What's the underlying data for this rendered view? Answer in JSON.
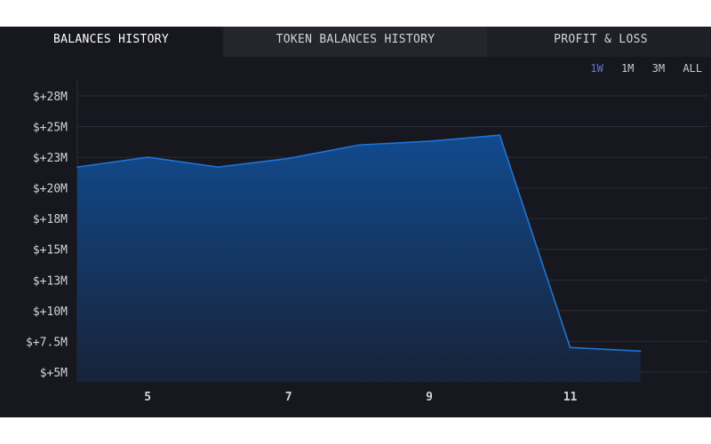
{
  "tabs": [
    {
      "label": "BALANCES HISTORY",
      "active": true
    },
    {
      "label": "TOKEN BALANCES HISTORY",
      "active": false
    },
    {
      "label": "PROFIT & LOSS",
      "active": false
    }
  ],
  "ranges": [
    {
      "label": "1W",
      "active": true
    },
    {
      "label": "1M",
      "active": false
    },
    {
      "label": "3M",
      "active": false
    },
    {
      "label": "ALL",
      "active": false
    }
  ],
  "colors": {
    "line": "#1e74d8",
    "fill_top": "#114a8e",
    "fill_bottom": "#172338",
    "grid": "#2c2d36",
    "active_range": "#6a73d6"
  },
  "chart_data": {
    "type": "area",
    "x": [
      4,
      5,
      6,
      7,
      8,
      9,
      10,
      11,
      12
    ],
    "values": [
      21.7,
      22.5,
      21.7,
      22.4,
      23.5,
      23.8,
      24.3,
      7.0,
      6.7
    ],
    "ylim": [
      4.2,
      28.8
    ],
    "yticks": [
      5,
      7.5,
      10,
      12.5,
      15,
      17.5,
      20,
      22.5,
      25,
      27.5
    ],
    "ytick_labels": [
      "$+5M",
      "$+7.5M",
      "$+10M",
      "$+13M",
      "$+15M",
      "$+18M",
      "$+20M",
      "$+23M",
      "$+25M",
      "$+28M"
    ],
    "xticks": [
      5,
      7,
      9,
      11
    ],
    "xtick_labels": [
      "5",
      "7",
      "9",
      "11"
    ],
    "xlim": [
      4,
      12.95
    ],
    "grid": true
  }
}
